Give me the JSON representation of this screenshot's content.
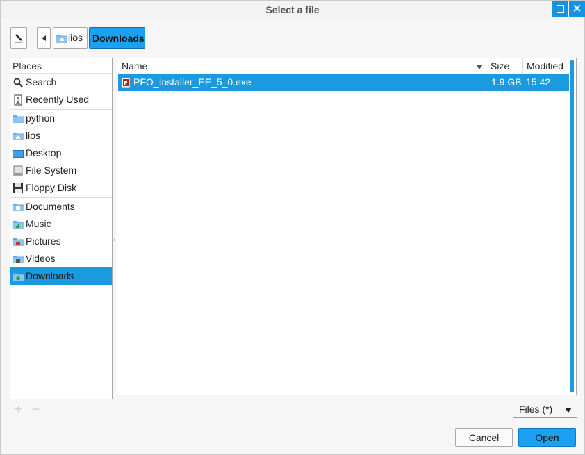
{
  "window": {
    "title": "Select a file"
  },
  "pathbar": {
    "crumbs": [
      "lios",
      "Downloads"
    ]
  },
  "places": {
    "header": "Places",
    "items": [
      {
        "label": "Search",
        "icon": "search-icon"
      },
      {
        "label": "Recently Used",
        "icon": "recent-icon"
      },
      {
        "label": "python",
        "icon": "folder-icon"
      },
      {
        "label": "lios",
        "icon": "home-folder-icon"
      },
      {
        "label": "Desktop",
        "icon": "desktop-icon"
      },
      {
        "label": "File System",
        "icon": "drive-icon"
      },
      {
        "label": "Floppy Disk",
        "icon": "floppy-icon"
      },
      {
        "label": "Documents",
        "icon": "documents-folder-icon"
      },
      {
        "label": "Music",
        "icon": "music-folder-icon"
      },
      {
        "label": "Pictures",
        "icon": "pictures-folder-icon"
      },
      {
        "label": "Videos",
        "icon": "videos-folder-icon"
      },
      {
        "label": "Downloads",
        "icon": "downloads-folder-icon"
      }
    ],
    "selected": "Downloads"
  },
  "filelist": {
    "columns": {
      "name": "Name",
      "size": "Size",
      "modified": "Modified"
    },
    "rows": [
      {
        "name": "PFO_Installer_EE_5_0.exe",
        "size": "1.9 GB",
        "modified": "15:42",
        "icon": "exe-file-icon"
      }
    ]
  },
  "bottom": {
    "add": "+",
    "remove": "−",
    "filter": "Files (*)",
    "cancel": "Cancel",
    "open": "Open"
  },
  "colors": {
    "accent": "#1a9be0",
    "button_accent": "#1ba1f2"
  }
}
